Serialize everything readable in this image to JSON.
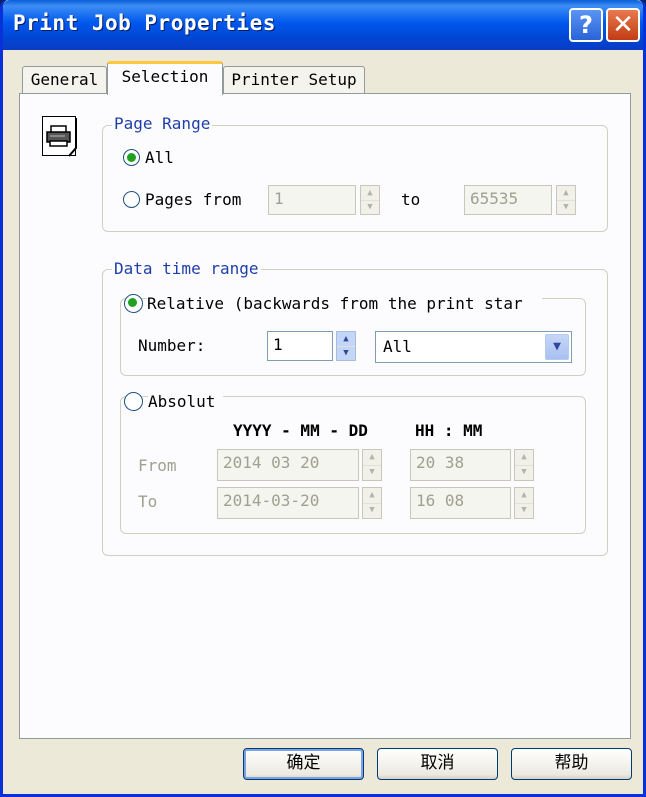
{
  "window": {
    "title": "Print Job Properties",
    "help_glyph": "?",
    "close_glyph": "✕"
  },
  "tabs": [
    {
      "label": "General",
      "active": false
    },
    {
      "label": "Selection",
      "active": true
    },
    {
      "label": "Printer Setup",
      "active": false
    }
  ],
  "page_range": {
    "legend": "Page Range",
    "all_label": "All",
    "all_checked": true,
    "pages_from_label": "Pages from",
    "from_value": "1",
    "to_label": "to",
    "to_value": "65535"
  },
  "data_time_range": {
    "legend": "Data time range",
    "relative": {
      "label": "Relative (backwards from the print star",
      "checked": true,
      "number_label": "Number:",
      "number_value": "1",
      "unit_value": "All"
    },
    "absolute": {
      "label": "Absolut",
      "checked": false,
      "date_header": "YYYY - MM - DD",
      "time_header": "HH : MM",
      "from_label": "From",
      "to_label": "To",
      "from_date": "2014 03 20",
      "from_time": "20 38",
      "to_date": "2014-03-20",
      "to_time": "16 08"
    }
  },
  "buttons": {
    "ok": "确定",
    "cancel": "取消",
    "help": "帮助"
  },
  "icons": {
    "printer": "printer-icon",
    "spin_up": "▲",
    "spin_down": "▼",
    "dropdown": "▼"
  },
  "colors": {
    "title_bar": "#0058ee",
    "accent_tab": "#ffc83c",
    "legend_text": "#1f3eaa"
  }
}
